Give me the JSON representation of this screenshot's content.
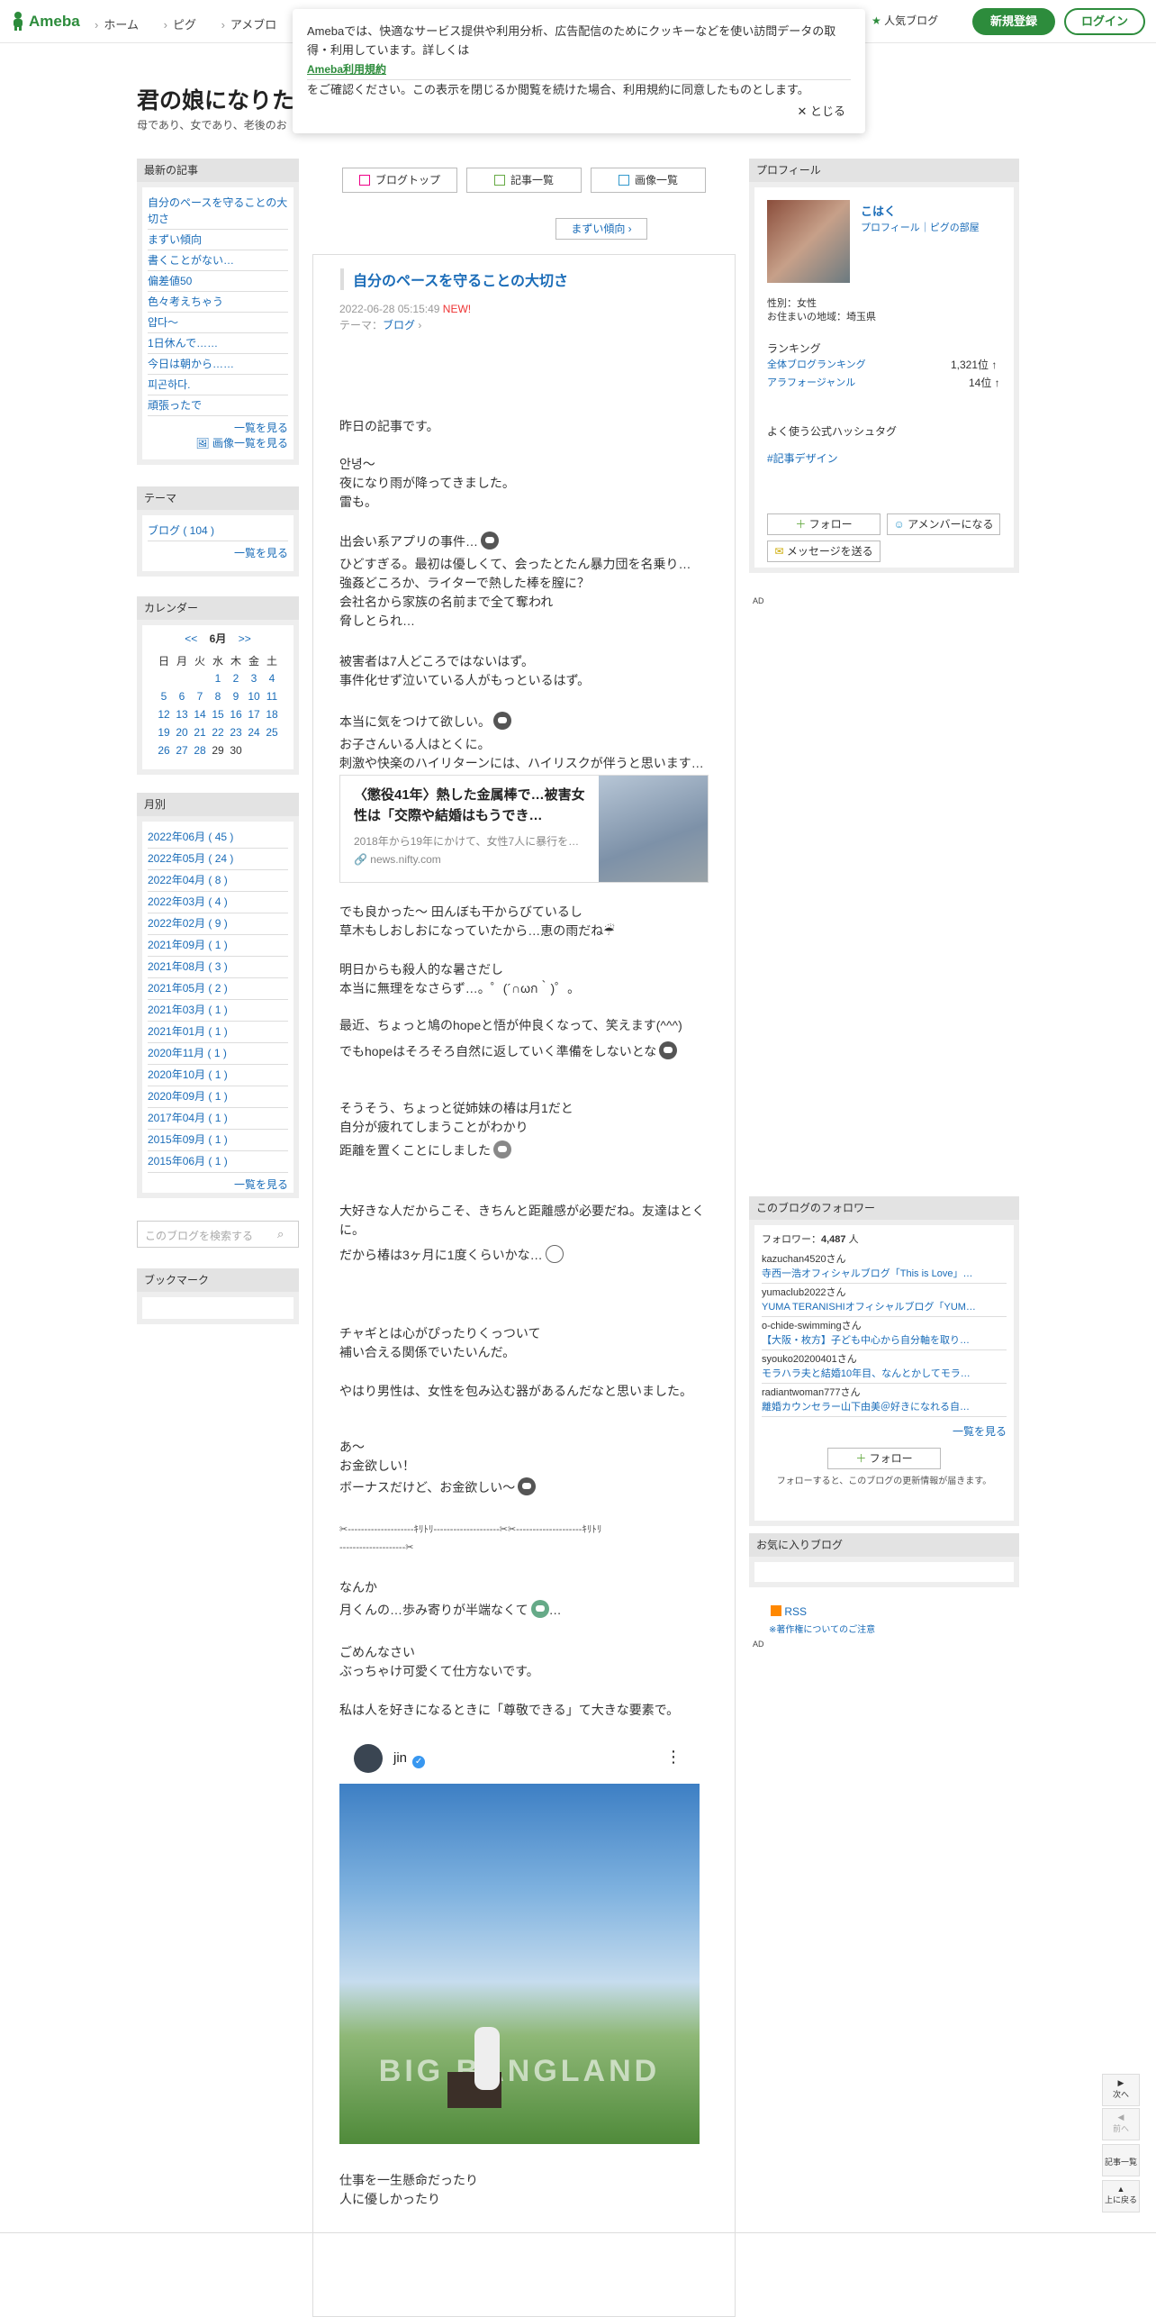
{
  "header": {
    "logo": "Ameba",
    "nav": [
      "ホーム",
      "ピグ",
      "アメブロ"
    ],
    "popular": "人気ブログ",
    "register": "新規登録",
    "login": "ログイン"
  },
  "cookie": {
    "text1": "Amebaでは、快適なサービス提供や利用分析、広告配信のためにクッキーなどを使い訪問データの取得・利用しています。詳しくは",
    "link": "Ameba利用規約",
    "text2": "をご確認ください。この表示を閉じるか閲覧を続けた場合、利用規約に同意したものとします。",
    "close": "✕ とじる"
  },
  "blog": {
    "title": "君の娘になりた",
    "desc": "母であり、女であり、老後のお"
  },
  "left": {
    "recent_title": "最新の記事",
    "recent": [
      "自分のペースを守ることの大切さ",
      "まずい傾向",
      "書くことがない…",
      "偏差値50",
      "色々考えちゃう",
      "얍다〜",
      "1日休んで……",
      "今日は朝から……",
      "피곤하다.",
      "頑張ったで"
    ],
    "recent_more": "一覧を見る",
    "image_more": "画像一覧を見る",
    "theme_title": "テーマ",
    "theme": "ブログ ( 104 )",
    "theme_more": "一覧を見る",
    "cal_title": "カレンダー",
    "cal_month": "6月",
    "cal_prev": "<<",
    "cal_next": ">>",
    "cal_days": [
      "日",
      "月",
      "火",
      "水",
      "木",
      "金",
      "土"
    ],
    "month_title": "月別",
    "months": [
      "2022年06月 ( 45 )",
      "2022年05月 ( 24 )",
      "2022年04月 ( 8 )",
      "2022年03月 ( 4 )",
      "2022年02月 ( 9 )",
      "2021年09月 ( 1 )",
      "2021年08月 ( 3 )",
      "2021年05月 ( 2 )",
      "2021年03月 ( 1 )",
      "2021年01月 ( 1 )",
      "2020年11月 ( 1 )",
      "2020年10月 ( 1 )",
      "2020年09月 ( 1 )",
      "2017年04月 ( 1 )",
      "2015年09月 ( 1 )",
      "2015年06月 ( 1 )"
    ],
    "month_more": "一覧を見る",
    "search_placeholder": "このブログを検索する",
    "bookmark_title": "ブックマーク"
  },
  "center": {
    "tab_top": "ブログトップ",
    "tab_list": "記事一覧",
    "tab_images": "画像一覧",
    "next_article": "まずい傾向 ›",
    "title": "自分のペースを守ることの大切さ",
    "date": "2022-06-28 05:15:49",
    "new": "NEW!",
    "theme_label": "テーマ：",
    "theme": "ブログ",
    "p1": "昨日の記事です。",
    "p2": "안녕〜\n夜になり雨が降ってきました。\n雷も。",
    "p3a": "出会い系アプリの事件…",
    "p3b": "ひどすぎる。最初は優しくて、会ったとたん暴力団を名乗り…\n強姦どころか、ライターで熱した棒を膣に？\n会社名から家族の名前まで全て奪われ\n脅しとられ…",
    "p4": "被害者は7人どころではないはず。\n事件化せず泣いている人がもっといるはず。",
    "p5a": "本当に気をつけて欲しい。",
    "p5b": "お子さんいる人はとくに。\n刺激や快楽のハイリターンには、ハイリスクが伴うと思います…",
    "card_title": "〈懲役41年〉熱した金属棒で…被害女性は「交際や結婚はもうでき…",
    "card_desc": "2018年から19年にかけて、女性7人に暴行を…",
    "card_url": "news.nifty.com",
    "p6": "でも良かった〜 田んぼも干からびているし\n草木もしおしおになっていたから…恵の雨だね☔",
    "p7": "明日からも殺人的な暑さだし\n本当に無理をなさらず…。゜(´∩ωก｀)゜。",
    "p8a": "最近、ちょっと鳩のhopeと悟が仲良くなって、笑えます(^^^)",
    "p8b": "でもhopeはそろそろ自然に返していく準備をしないとな",
    "p9a": "そうそう、ちょっと従姉妹の椿は月1だと\n自分が疲れてしまうことがわかり",
    "p9b": "距離を置くことにしました",
    "p10a": "大好きな人だからこそ、きちんと距離感が必要だね。友達はとくに。",
    "p10b": "だから椿は3ヶ月に1度くらいかな…",
    "p11": "チャギとは心がぴったりくっついて\n補い合える関係でいたいんだ。",
    "p12": "やはり男性は、女性を包み込む器があるんだなと思いました。",
    "p13a": "あ〜\nお金欲しい！",
    "p13b": "ボーナスだけど、お金欲しい〜",
    "sep1": "✂--------------------ｷﾘﾄﾘ--------------------✂✂--------------------ｷﾘﾄﾘ",
    "sep2": "--------------------✂",
    "p14a": "なんか",
    "p14b": "月くんの…歩み寄りが半端なくて",
    "p14c": "…",
    "p15": "ごめんなさい\nぶっちゃけ可愛くて仕方ないです。",
    "p16": "私は人を好きになるときに「尊敬できる」て大きな要素で。",
    "insta_name": "jin",
    "insta_photo_text": "BIG BANGLAND",
    "p17": "仕事を一生懸命だったり\n人に優しかったり"
  },
  "right": {
    "profile_title": "プロフィール",
    "name": "こはく",
    "links": "プロフィール｜ピグの部屋",
    "gender": "性別：女性",
    "location": "お住まいの地域：埼玉県",
    "ranking_title": "ランキング",
    "rank1_label": "全体ブログランキング",
    "rank1_value": "1,321位 ↑",
    "rank2_label": "アラフォージャンル",
    "rank2_value": "14位 ↑",
    "hashtag_title": "よく使う公式ハッシュタグ",
    "hashtag": "#記事デザイン",
    "follow": "フォロー",
    "member": "アメンバーになる",
    "message": "メッセージを送る",
    "ad": "AD",
    "followers_title": "このブログのフォロワー",
    "followers_count_label": "フォロワー：",
    "followers_count": "4,487",
    "followers_unit": "人",
    "followers": [
      {
        "user": "kazuchan4520さん",
        "blog": "寺西一浩オフィシャルブログ「This is Love」…"
      },
      {
        "user": "yumaclub2022さん",
        "blog": "YUMA TERANISHIオフィシャルブログ「YUM…"
      },
      {
        "user": "o-chide-swimmingさん",
        "blog": "【大阪・枚方】子ども中心から自分軸を取り…"
      },
      {
        "user": "syouko20200401さん",
        "blog": "モラハラ夫と結婚10年目、なんとかしてモラ…"
      },
      {
        "user": "radiantwoman777さん",
        "blog": "離婚カウンセラー山下由美＠好きになれる自…"
      }
    ],
    "followers_more": "一覧を見る",
    "follow2": "フォロー",
    "follow_note": "フォローすると、このブログの更新情報が届きます。",
    "fav_title": "お気に入りブログ",
    "rss": "RSS",
    "copyright": "※著作権についてのご注意",
    "ad2": "AD"
  },
  "sidenav": {
    "next": "次へ",
    "prev": "前へ",
    "list": "記事一覧",
    "top": "上に戻る"
  }
}
